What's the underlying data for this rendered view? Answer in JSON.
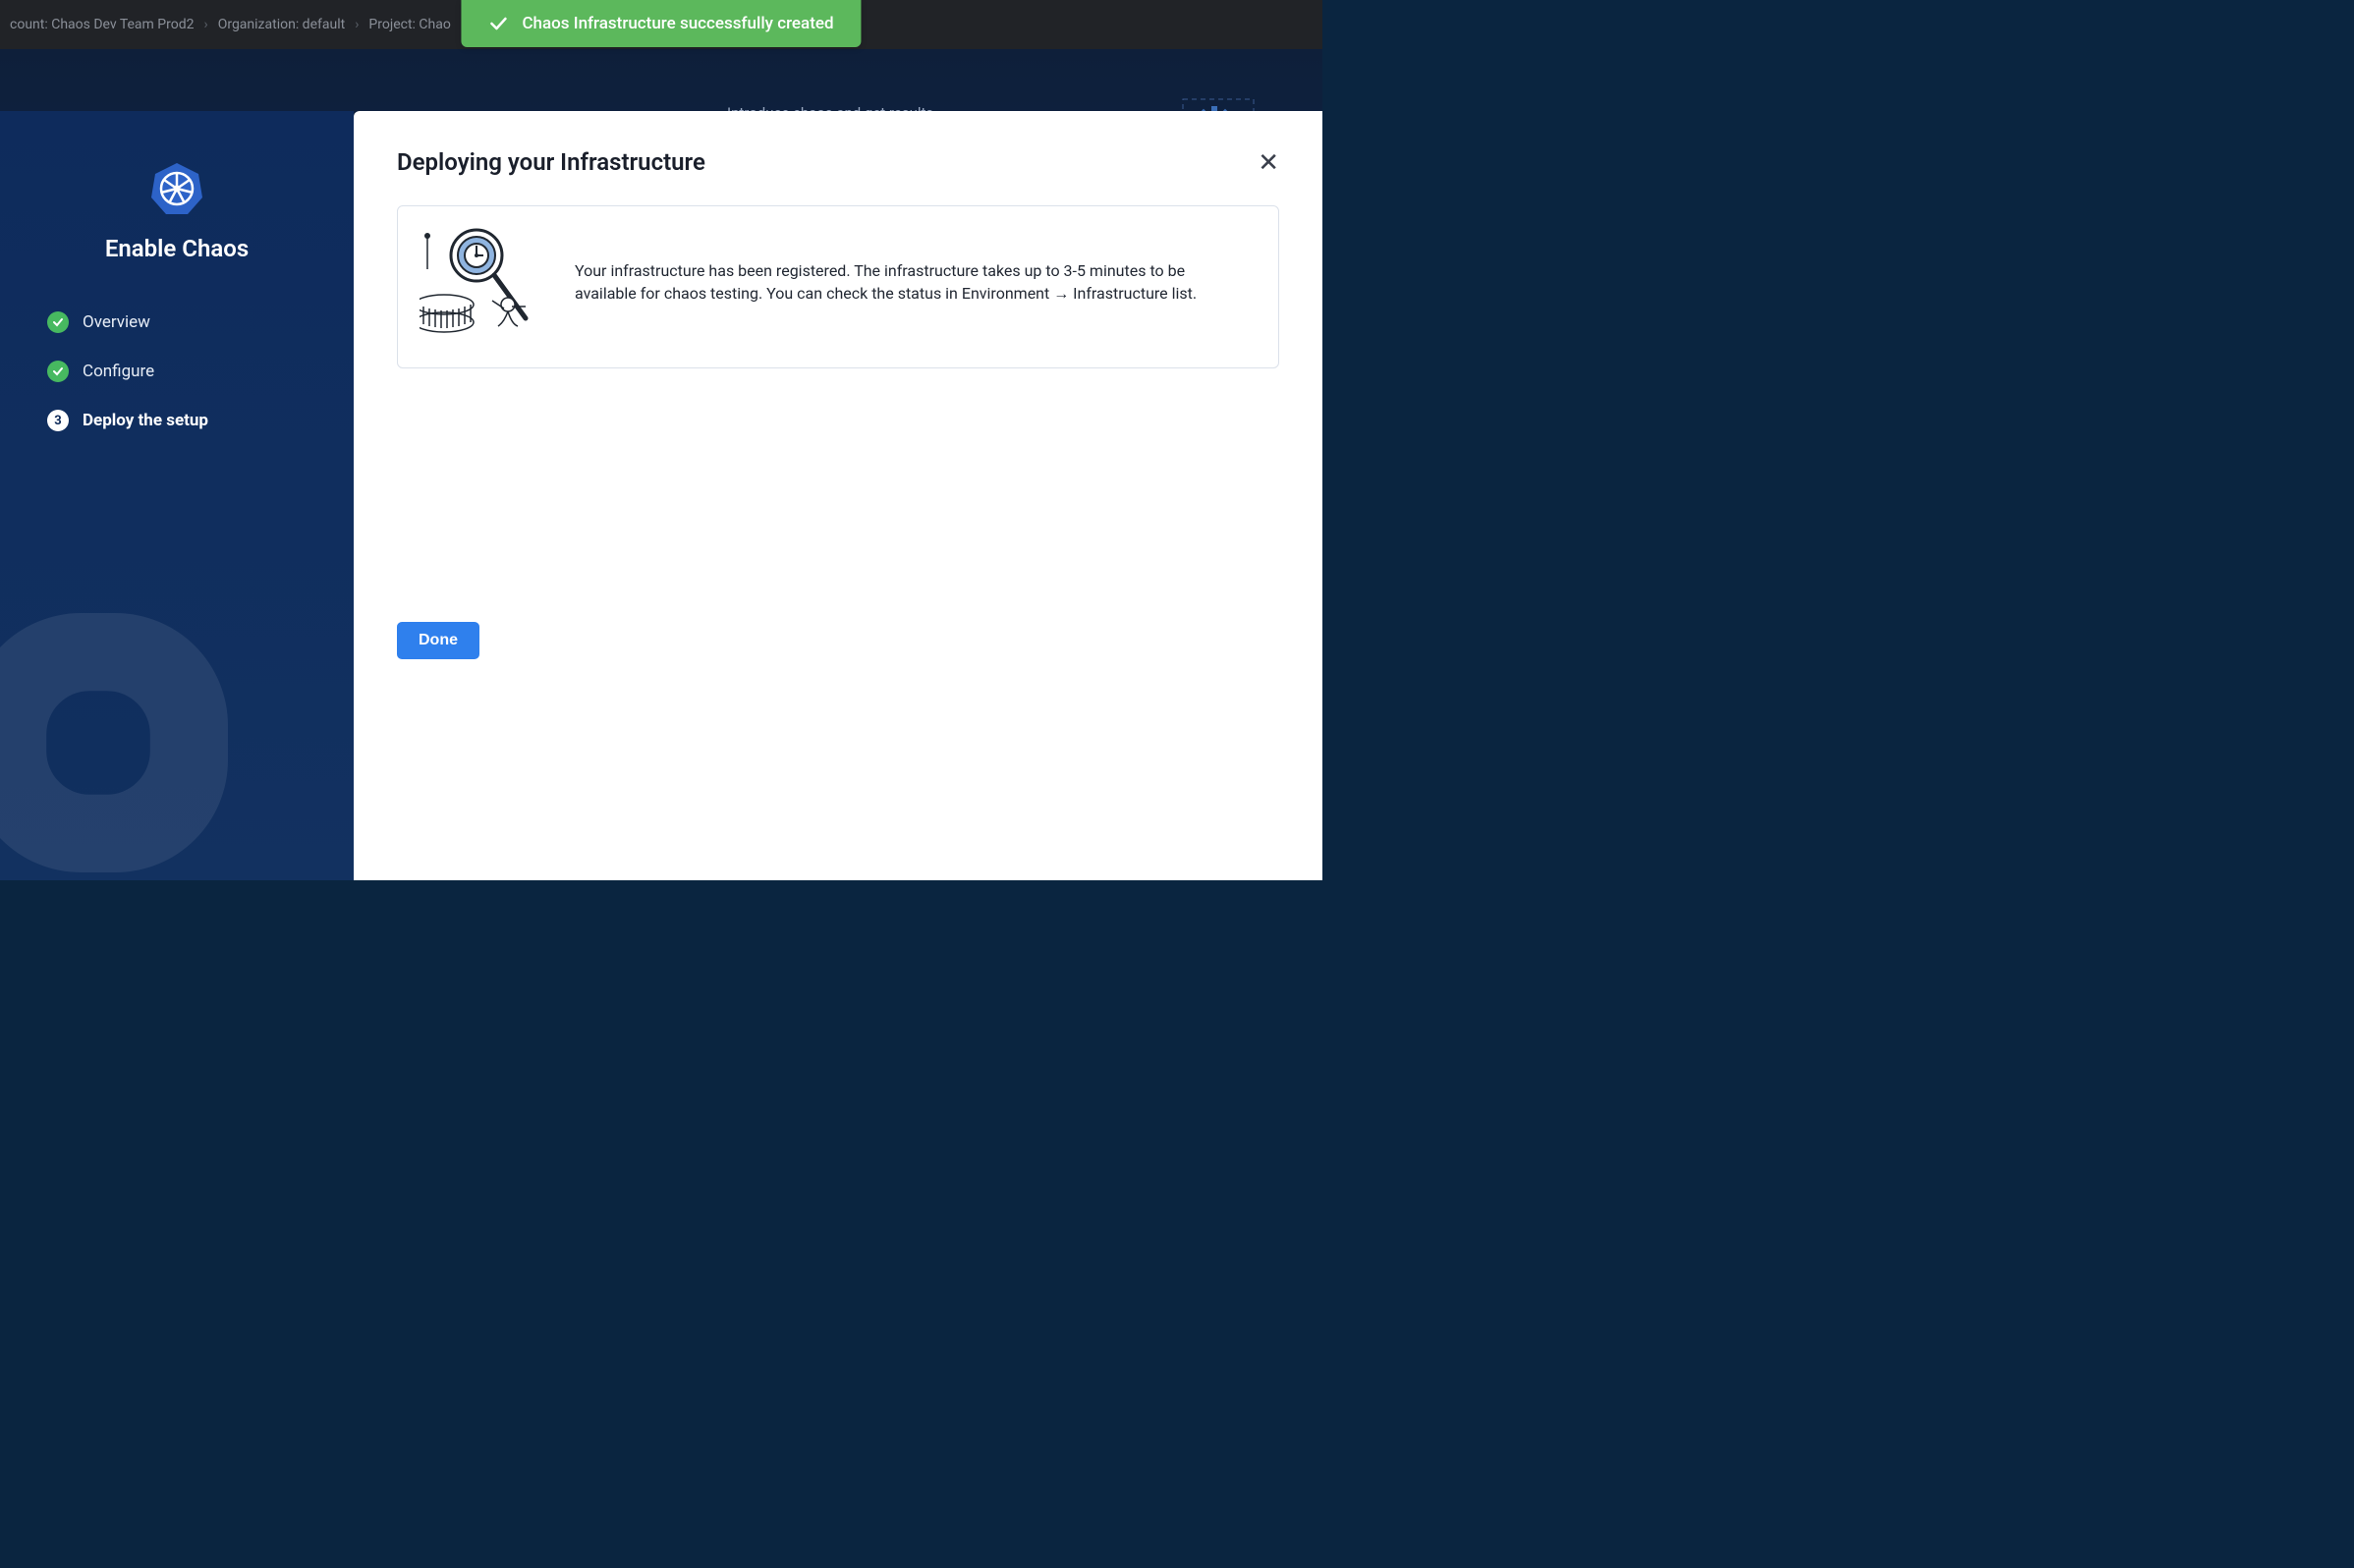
{
  "colors": {
    "accent": "#2f80ed",
    "success": "#5cb85c",
    "sidebar": "#0e2a5a"
  },
  "toast": {
    "message": "Chaos Infrastructure successfully created"
  },
  "breadcrumb": {
    "account_label": "count: Chaos Dev Team Prod2",
    "org_label": "Organization: default",
    "project_label": "Project: Chao"
  },
  "hero": {
    "tagline": "Introduce chaos and get results"
  },
  "wizard": {
    "title": "Enable Chaos",
    "steps": [
      {
        "label": "Overview",
        "state": "done"
      },
      {
        "label": "Configure",
        "state": "done"
      },
      {
        "label": "Deploy the setup",
        "state": "active",
        "index": "3"
      }
    ]
  },
  "panel": {
    "title": "Deploying your Infrastructure",
    "message": "Your infrastructure has been registered. The infrastructure takes up to 3-5 minutes to be available for chaos testing. You can check the status in Environment → Infrastructure list.",
    "done_label": "Done"
  }
}
